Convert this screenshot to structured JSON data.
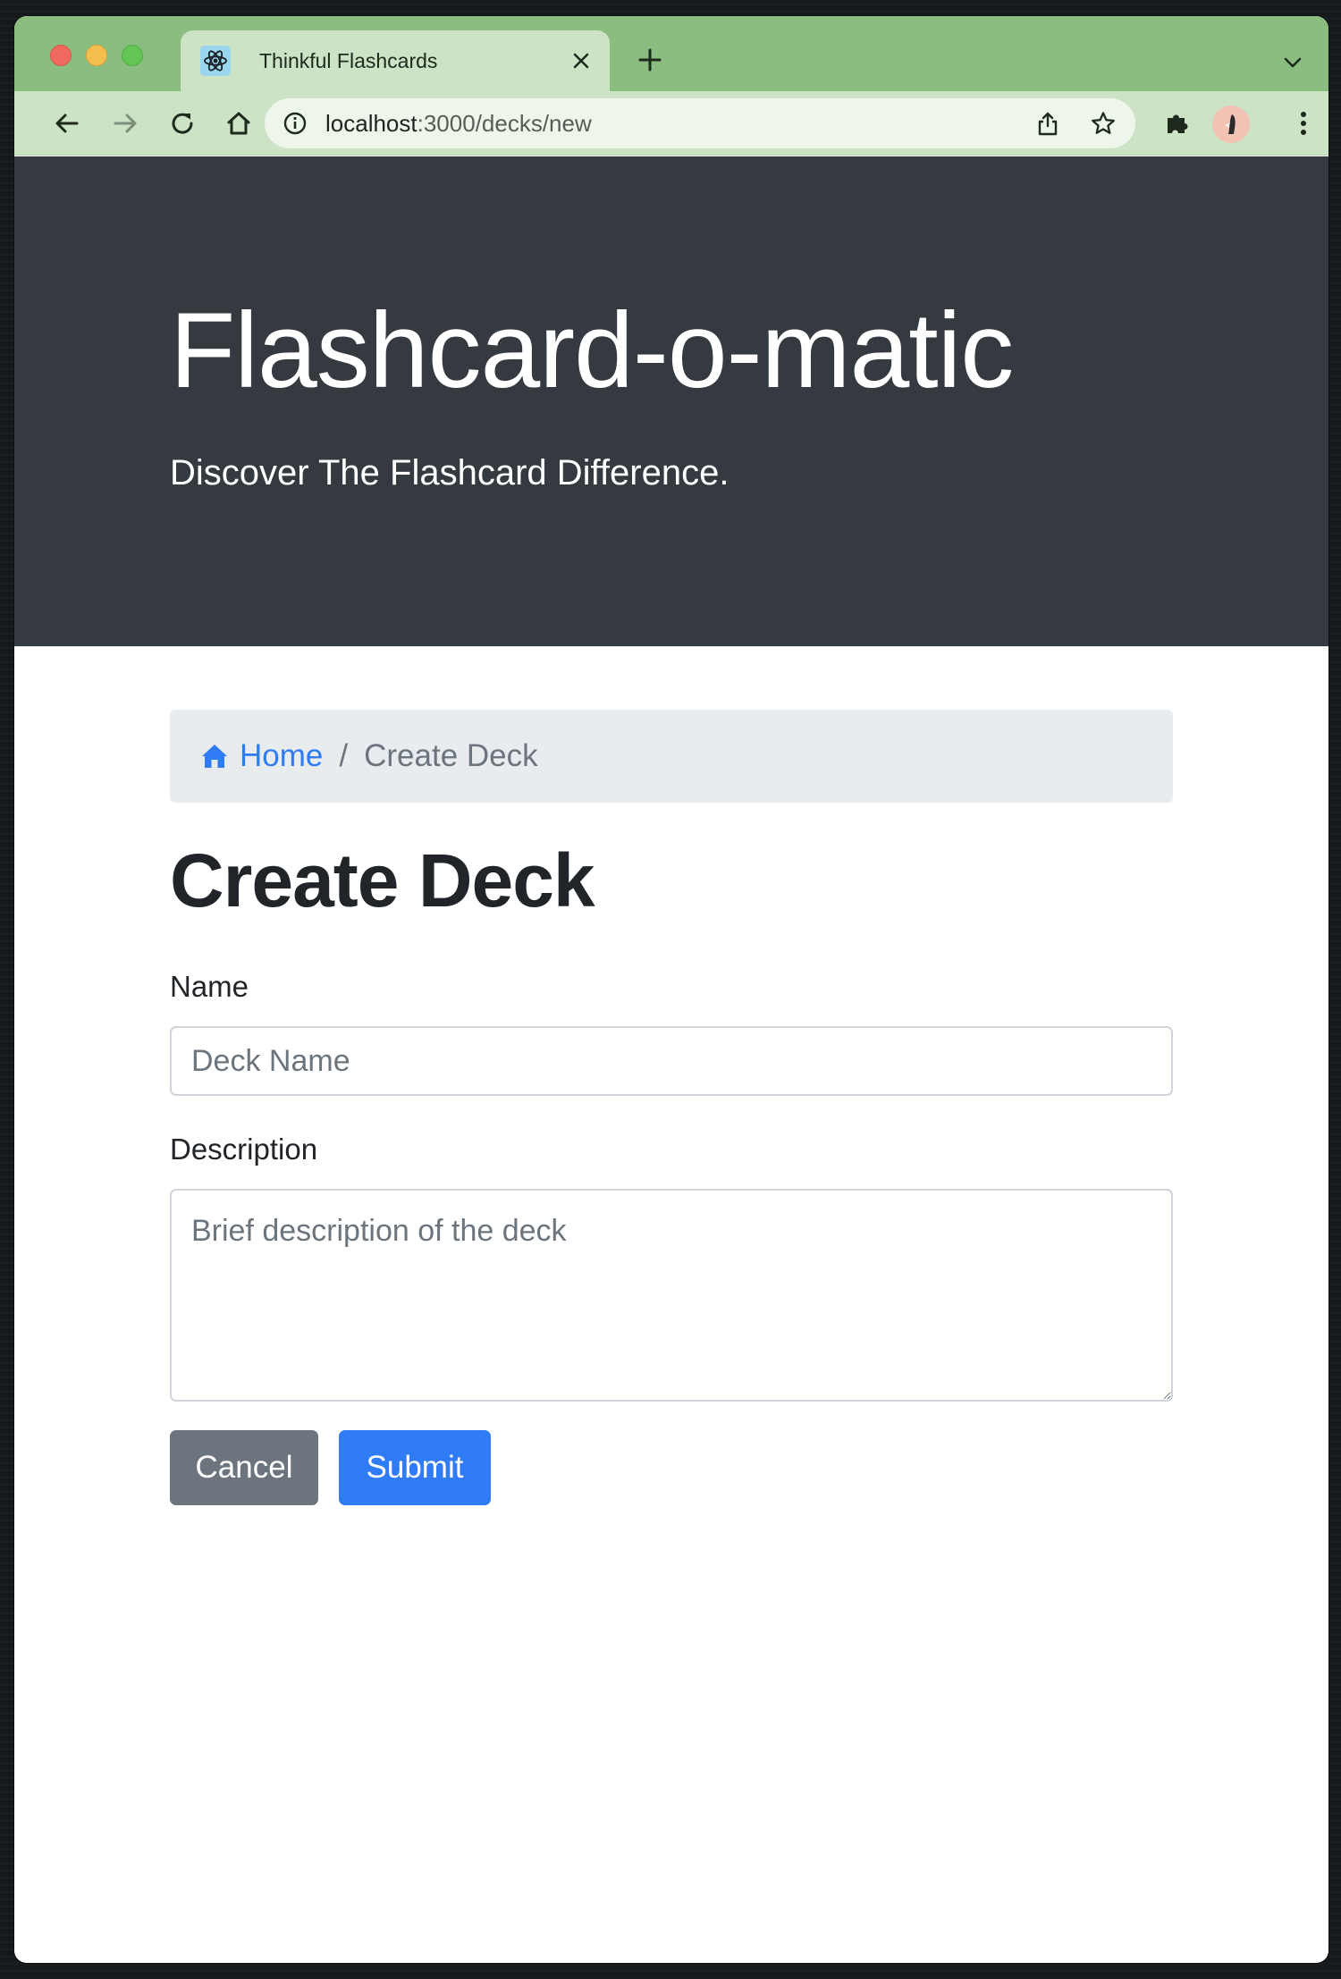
{
  "browser": {
    "tab_title": "Thinkful Flashcards",
    "url_host": "localhost",
    "url_path": ":3000/decks/new"
  },
  "hero": {
    "title": "Flashcard-o-matic",
    "subtitle": "Discover The Flashcard Difference."
  },
  "breadcrumb": {
    "home_label": "Home",
    "separator": "/",
    "current_label": "Create Deck"
  },
  "form": {
    "title": "Create Deck",
    "name_label": "Name",
    "name_placeholder": "Deck Name",
    "name_value": "",
    "description_label": "Description",
    "description_placeholder": "Brief description of the deck",
    "description_value": "",
    "cancel_label": "Cancel",
    "submit_label": "Submit"
  },
  "colors": {
    "hero_bg": "#343a40",
    "primary": "#2f7cf6",
    "secondary": "#6c757d",
    "breadcrumb_bg": "#e9ecef",
    "browser_frame": "#8bbd80",
    "browser_toolbar": "#cce3c5"
  },
  "icons": {
    "tab_favicon": "react-atom-icon",
    "breadcrumb_home": "home-icon"
  }
}
